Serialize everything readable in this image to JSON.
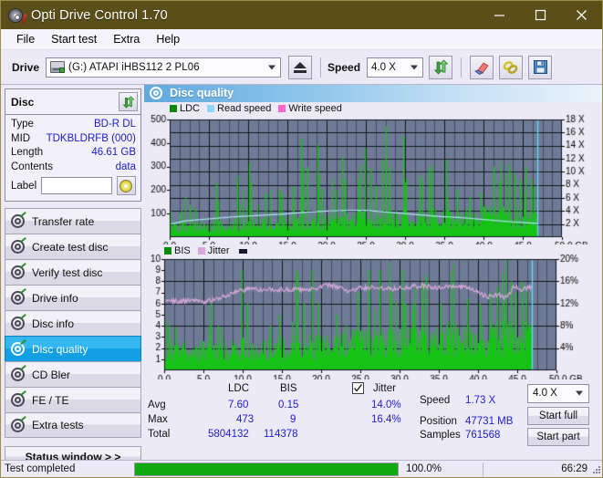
{
  "window": {
    "title": "Opti Drive Control 1.70",
    "icon": "disc-pen-icon",
    "minimize": "minimize-icon",
    "maximize": "maximize-icon",
    "close": "close-icon",
    "titlebar_color": "#5a4e19"
  },
  "menu": {
    "items": [
      "File",
      "Start test",
      "Extra",
      "Help"
    ]
  },
  "toolbar": {
    "drive_label": "Drive",
    "drive_value": "(G:)  ATAPI iHBS112  2 PL06",
    "eject_icon": "eject-icon",
    "speed_label": "Speed",
    "speed_value": "4.0 X",
    "refresh_icon": "refresh-icon",
    "eraser_icon": "eraser-icon",
    "chain_icon": "link-icon",
    "save_icon": "floppy-save-icon"
  },
  "disc": {
    "heading": "Disc",
    "refresh_icon": "refresh-green-icon",
    "rows": [
      {
        "key": "Type",
        "value": "BD-R DL"
      },
      {
        "key": "MID",
        "value": "TDKBLDRFB (000)"
      },
      {
        "key": "Length",
        "value": "46.61 GB"
      },
      {
        "key": "Contents",
        "value": "data"
      }
    ],
    "label_key": "Label",
    "label_value": "",
    "label_placeholder": "",
    "disc_button_icon": "cd-disc-icon"
  },
  "nav": {
    "items": [
      {
        "label": "Transfer rate",
        "active": false
      },
      {
        "label": "Create test disc",
        "active": false
      },
      {
        "label": "Verify test disc",
        "active": false
      },
      {
        "label": "Drive info",
        "active": false
      },
      {
        "label": "Disc info",
        "active": false
      },
      {
        "label": "Disc quality",
        "active": true
      },
      {
        "label": "CD Bler",
        "active": false
      },
      {
        "label": "FE / TE",
        "active": false
      },
      {
        "label": "Extra tests",
        "active": false
      }
    ],
    "status_window": "Status window > >"
  },
  "panel": {
    "title": "Disc quality",
    "icon": "disc-quality-icon"
  },
  "stats": {
    "col_headers": [
      "LDC",
      "BIS"
    ],
    "jitter_label": "Jitter",
    "jitter_checked": true,
    "rows": [
      {
        "key": "Avg",
        "ldc": "7.60",
        "bis": "0.15",
        "jitter": "14.0%"
      },
      {
        "key": "Max",
        "ldc": "473",
        "bis": "9",
        "jitter": "16.4%"
      },
      {
        "key": "Total",
        "ldc": "5804132",
        "bis": "114378",
        "jitter": ""
      }
    ],
    "speed_key": "Speed",
    "speed_value": "1.73 X",
    "position_key": "Position",
    "position_value": "47731 MB",
    "samples_key": "Samples",
    "samples_value": "761568",
    "speed_select": "4.0 X",
    "start_full": "Start full",
    "start_part": "Start part"
  },
  "statusbar": {
    "text": "Test completed",
    "percent_label": "100.0%",
    "percent_value": 100,
    "time": "66:29",
    "progress_color": "#10aa10",
    "grip_icon": "resize-grip-icon"
  },
  "chart_data": [
    {
      "type": "line",
      "id": "ldc-chart",
      "title": "",
      "xlabel": "GB",
      "ylabel": "",
      "xlim": [
        0,
        50
      ],
      "ylim": [
        0,
        500
      ],
      "y2lim": [
        0,
        18
      ],
      "y2label": "X",
      "xticks": [
        0.0,
        5.0,
        10.0,
        15.0,
        20.0,
        25.0,
        30.0,
        35.0,
        40.0,
        45.0,
        50.0
      ],
      "xticklabels": [
        "0.0",
        "5.0",
        "10.0",
        "15.0",
        "20.0",
        "25.0",
        "30.0",
        "35.0",
        "40.0",
        "45.0",
        "50.0 GB"
      ],
      "yticks": [
        100,
        200,
        300,
        400,
        500
      ],
      "y2ticks": [
        2,
        4,
        6,
        8,
        10,
        12,
        14,
        16,
        18
      ],
      "y2ticklabels": [
        "2 X",
        "4 X",
        "6 X",
        "8 X",
        "10 X",
        "12 X",
        "14 X",
        "16 X",
        "18 X"
      ],
      "grid": true,
      "legend": [
        {
          "name": "LDC",
          "color": "#0a8a0a"
        },
        {
          "name": "Read speed",
          "color": "#8fd6f2"
        },
        {
          "name": "Write speed",
          "color": "#ff66cc"
        }
      ],
      "data_end_gb": 46.9,
      "ldc_baseline": [
        45,
        48,
        52,
        50,
        55,
        58,
        55,
        60,
        62,
        58,
        65,
        68,
        64,
        70,
        72,
        68,
        75,
        78,
        74,
        80,
        85,
        82,
        88,
        90,
        86,
        92,
        95,
        90,
        96,
        98,
        94,
        100,
        102,
        98,
        104,
        106,
        102,
        108,
        105,
        100,
        96,
        92,
        88,
        84,
        80,
        76,
        72
      ],
      "ldc_peaks": [
        {
          "x": 2.6,
          "y": 138
        },
        {
          "x": 3.3,
          "y": 122
        },
        {
          "x": 5.9,
          "y": 228
        },
        {
          "x": 6.2,
          "y": 150
        },
        {
          "x": 8.6,
          "y": 258
        },
        {
          "x": 10.1,
          "y": 318
        },
        {
          "x": 10.4,
          "y": 233
        },
        {
          "x": 12.2,
          "y": 188
        },
        {
          "x": 13.9,
          "y": 205
        },
        {
          "x": 14.3,
          "y": 186
        },
        {
          "x": 15.7,
          "y": 216
        },
        {
          "x": 16.8,
          "y": 418
        },
        {
          "x": 17.0,
          "y": 290
        },
        {
          "x": 17.6,
          "y": 300
        },
        {
          "x": 18.8,
          "y": 393
        },
        {
          "x": 19.0,
          "y": 265
        },
        {
          "x": 19.4,
          "y": 205
        },
        {
          "x": 21.2,
          "y": 200
        },
        {
          "x": 22.0,
          "y": 340
        },
        {
          "x": 22.3,
          "y": 248
        },
        {
          "x": 24.3,
          "y": 305
        },
        {
          "x": 24.9,
          "y": 378
        },
        {
          "x": 25.6,
          "y": 290
        },
        {
          "x": 26.3,
          "y": 218
        },
        {
          "x": 27.1,
          "y": 330
        },
        {
          "x": 27.6,
          "y": 473
        },
        {
          "x": 28.0,
          "y": 300
        },
        {
          "x": 29.8,
          "y": 430
        },
        {
          "x": 30.1,
          "y": 250
        },
        {
          "x": 31.9,
          "y": 262
        },
        {
          "x": 33.0,
          "y": 290
        },
        {
          "x": 33.4,
          "y": 305
        },
        {
          "x": 35.2,
          "y": 330
        },
        {
          "x": 36.6,
          "y": 205
        },
        {
          "x": 38.2,
          "y": 170
        },
        {
          "x": 39.6,
          "y": 190
        },
        {
          "x": 41.3,
          "y": 300
        },
        {
          "x": 42.0,
          "y": 240
        },
        {
          "x": 43.2,
          "y": 310
        },
        {
          "x": 43.9,
          "y": 270
        },
        {
          "x": 44.6,
          "y": 245
        },
        {
          "x": 45.4,
          "y": 300
        },
        {
          "x": 46.0,
          "y": 250
        },
        {
          "x": 46.4,
          "y": 215
        }
      ],
      "read_speed": [
        {
          "x": 0.0,
          "y": 2.0
        },
        {
          "x": 2.0,
          "y": 2.5
        },
        {
          "x": 5.0,
          "y": 2.8
        },
        {
          "x": 8.0,
          "y": 3.1
        },
        {
          "x": 11.0,
          "y": 3.3
        },
        {
          "x": 14.0,
          "y": 3.5
        },
        {
          "x": 17.0,
          "y": 3.8
        },
        {
          "x": 20.0,
          "y": 4.0
        },
        {
          "x": 23.0,
          "y": 4.1
        },
        {
          "x": 25.0,
          "y": 4.1
        },
        {
          "x": 28.0,
          "y": 3.8
        },
        {
          "x": 31.0,
          "y": 3.5
        },
        {
          "x": 34.0,
          "y": 3.2
        },
        {
          "x": 37.0,
          "y": 3.0
        },
        {
          "x": 40.0,
          "y": 2.7
        },
        {
          "x": 43.0,
          "y": 2.4
        },
        {
          "x": 46.9,
          "y": 2.1
        }
      ],
      "end_marker_gb": 46.9
    },
    {
      "type": "line",
      "id": "bis-chart",
      "title": "",
      "xlabel": "GB",
      "ylabel": "",
      "xlim": [
        0,
        50
      ],
      "ylim": [
        0,
        10
      ],
      "y2lim": [
        0,
        20
      ],
      "y2label": "%",
      "xticks": [
        0.0,
        5.0,
        10.0,
        15.0,
        20.0,
        25.0,
        30.0,
        35.0,
        40.0,
        45.0,
        50.0
      ],
      "xticklabels": [
        "0.0",
        "5.0",
        "10.0",
        "15.0",
        "20.0",
        "25.0",
        "30.0",
        "35.0",
        "40.0",
        "45.0",
        "50.0 GB"
      ],
      "yticks": [
        1,
        2,
        3,
        4,
        5,
        6,
        7,
        8,
        9,
        10
      ],
      "y2ticks": [
        4,
        8,
        12,
        16,
        20
      ],
      "y2ticklabels": [
        "4%",
        "8%",
        "12%",
        "16%",
        "20%"
      ],
      "grid": true,
      "legend": [
        {
          "name": "BIS",
          "color": "#0a8a0a"
        },
        {
          "name": "Jitter",
          "color": "#d9a8dc"
        }
      ],
      "data_end_gb": 46.9,
      "bis_baseline": [
        2.0,
        2.1,
        2.0,
        2.2,
        2.0,
        2.1,
        2.3,
        2.2,
        2.1,
        2.3,
        2.4,
        2.3,
        2.5,
        2.4,
        2.3,
        2.5,
        2.6,
        2.5,
        2.7,
        2.6,
        2.5,
        2.8,
        2.9,
        2.8,
        3.0,
        3.1,
        3.0,
        3.2,
        3.1,
        3.0,
        3.2,
        3.3,
        3.2,
        3.4,
        3.3,
        3.2,
        3.4,
        3.5,
        3.4,
        3.6,
        3.5,
        3.4,
        3.6,
        3.7,
        3.6,
        3.8,
        3.6
      ],
      "bis_peaks": [
        {
          "x": 0.6,
          "y": 4.0
        },
        {
          "x": 1.4,
          "y": 3.9
        },
        {
          "x": 5.9,
          "y": 6.0
        },
        {
          "x": 6.9,
          "y": 4.0
        },
        {
          "x": 9.9,
          "y": 9.0
        },
        {
          "x": 10.6,
          "y": 6.0
        },
        {
          "x": 13.5,
          "y": 4.0
        },
        {
          "x": 14.6,
          "y": 5.0
        },
        {
          "x": 16.9,
          "y": 9.0
        },
        {
          "x": 17.8,
          "y": 6.0
        },
        {
          "x": 18.8,
          "y": 9.0
        },
        {
          "x": 19.6,
          "y": 6.0
        },
        {
          "x": 22.0,
          "y": 5.0
        },
        {
          "x": 23.1,
          "y": 4.0
        },
        {
          "x": 24.6,
          "y": 7.0
        },
        {
          "x": 26.0,
          "y": 9.0
        },
        {
          "x": 27.4,
          "y": 9.0
        },
        {
          "x": 29.0,
          "y": 7.0
        },
        {
          "x": 30.3,
          "y": 9.0
        },
        {
          "x": 31.6,
          "y": 6.0
        },
        {
          "x": 32.9,
          "y": 8.0
        },
        {
          "x": 33.4,
          "y": 8.5
        },
        {
          "x": 35.2,
          "y": 6.0
        },
        {
          "x": 36.5,
          "y": 5.0
        },
        {
          "x": 38.6,
          "y": 6.5
        },
        {
          "x": 40.2,
          "y": 6.0
        },
        {
          "x": 41.5,
          "y": 7.0
        },
        {
          "x": 42.4,
          "y": 7.5
        },
        {
          "x": 43.3,
          "y": 6.0
        },
        {
          "x": 44.2,
          "y": 8.0
        },
        {
          "x": 44.8,
          "y": 7.0
        },
        {
          "x": 45.6,
          "y": 8.0
        },
        {
          "x": 46.2,
          "y": 7.5
        }
      ],
      "jitter_pct": [
        {
          "x": 0.0,
          "y": 12.6
        },
        {
          "x": 1.5,
          "y": 12.4
        },
        {
          "x": 3.0,
          "y": 12.5
        },
        {
          "x": 5.0,
          "y": 12.3
        },
        {
          "x": 6.5,
          "y": 12.8
        },
        {
          "x": 8.0,
          "y": 13.6
        },
        {
          "x": 9.5,
          "y": 14.3
        },
        {
          "x": 11.0,
          "y": 14.6
        },
        {
          "x": 13.0,
          "y": 14.4
        },
        {
          "x": 15.0,
          "y": 14.6
        },
        {
          "x": 17.0,
          "y": 14.5
        },
        {
          "x": 19.0,
          "y": 14.7
        },
        {
          "x": 21.0,
          "y": 15.3
        },
        {
          "x": 22.0,
          "y": 15.0
        },
        {
          "x": 23.5,
          "y": 14.2
        },
        {
          "x": 25.0,
          "y": 14.8
        },
        {
          "x": 27.0,
          "y": 14.9
        },
        {
          "x": 29.0,
          "y": 14.7
        },
        {
          "x": 31.0,
          "y": 15.0
        },
        {
          "x": 33.0,
          "y": 15.2
        },
        {
          "x": 35.0,
          "y": 14.8
        },
        {
          "x": 37.0,
          "y": 15.1
        },
        {
          "x": 39.0,
          "y": 14.6
        },
        {
          "x": 40.5,
          "y": 13.6
        },
        {
          "x": 41.5,
          "y": 13.2
        },
        {
          "x": 42.5,
          "y": 13.6
        },
        {
          "x": 43.5,
          "y": 13.0
        },
        {
          "x": 44.5,
          "y": 15.0
        },
        {
          "x": 45.5,
          "y": 14.6
        },
        {
          "x": 46.9,
          "y": 15.0
        }
      ],
      "end_marker_gb": 46.9
    }
  ]
}
